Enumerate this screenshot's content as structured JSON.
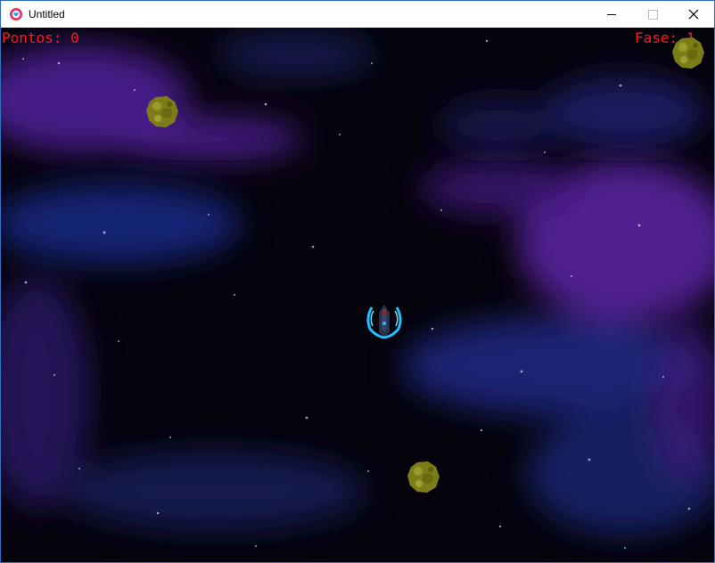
{
  "window": {
    "title": "Untitled",
    "controls": [
      "minimize-icon",
      "maximize-icon",
      "close-icon"
    ]
  },
  "hud": {
    "score_text": "Pontos: 0",
    "level_text": "Fase: 1",
    "text_color": "#ff1a1a"
  },
  "game": {
    "background_color": "#05030b",
    "nebula_colors": [
      "#4a1a8c",
      "#1a1f6e"
    ],
    "asteroid_color": "#8a8a1a",
    "ship_glow_color": "#1ec0ff",
    "asteroid_count": 3,
    "ship_count": 1
  }
}
